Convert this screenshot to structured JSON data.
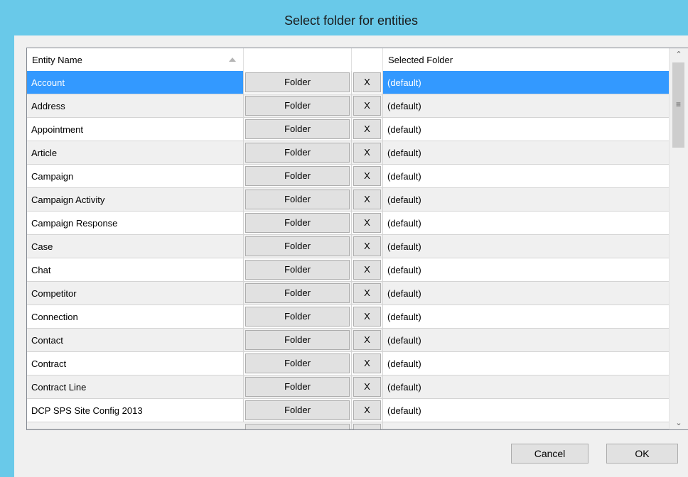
{
  "window": {
    "title": "Select folder for entities"
  },
  "grid": {
    "columns": [
      "Entity Name",
      "",
      "",
      "Selected Folder"
    ],
    "folder_button_label": "Folder",
    "clear_button_label": "X",
    "rows": [
      {
        "name": "Account",
        "folder": "(default)"
      },
      {
        "name": "Address",
        "folder": "(default)"
      },
      {
        "name": "Appointment",
        "folder": "(default)"
      },
      {
        "name": "Article",
        "folder": "(default)"
      },
      {
        "name": "Campaign",
        "folder": "(default)"
      },
      {
        "name": "Campaign Activity",
        "folder": "(default)"
      },
      {
        "name": "Campaign Response",
        "folder": "(default)"
      },
      {
        "name": "Case",
        "folder": "(default)"
      },
      {
        "name": "Chat",
        "folder": "(default)"
      },
      {
        "name": "Competitor",
        "folder": "(default)"
      },
      {
        "name": "Connection",
        "folder": "(default)"
      },
      {
        "name": "Contact",
        "folder": "(default)"
      },
      {
        "name": "Contract",
        "folder": "(default)"
      },
      {
        "name": "Contract Line",
        "folder": "(default)"
      },
      {
        "name": "DCP SPS Site Config 2013",
        "folder": "(default)"
      }
    ],
    "selected_row": "Account"
  },
  "buttons": {
    "cancel": "Cancel",
    "ok": "OK"
  },
  "icons": {
    "sort": "sort-ascending-icon",
    "scroll_up": "scroll-up-icon",
    "scroll_down": "scroll-down-icon",
    "grip": "scroll-grip-icon"
  },
  "colors": {
    "title_bar": "#69c9e9",
    "selection": "#3399ff"
  }
}
